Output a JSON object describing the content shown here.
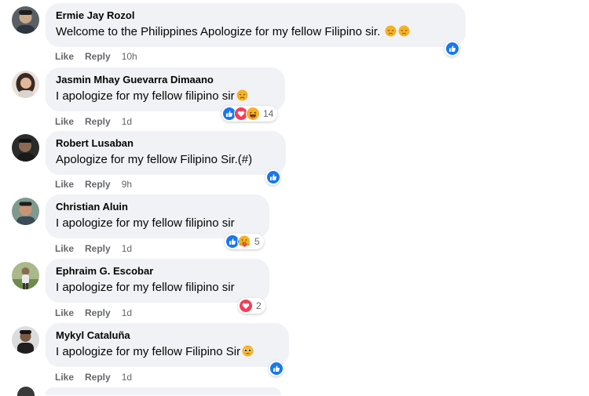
{
  "action_labels": {
    "like": "Like",
    "reply": "Reply"
  },
  "comments": [
    {
      "author": "Ermie Jay Rozol",
      "text": "Welcome to the Philippines Apologize for my fellow Filipino sir. ",
      "time": "10h",
      "emoji": [
        "downcast-face-icon",
        "downcast-face-icon"
      ],
      "reactions": [
        "like"
      ],
      "reaction_count": ""
    },
    {
      "author": "Jasmin Mhay Guevarra Dimaano",
      "text": "I apologize for my fellow filipino sir",
      "time": "1d",
      "emoji": [
        "disappointed-face-icon"
      ],
      "reactions": [
        "like",
        "love",
        "haha"
      ],
      "reaction_count": "14"
    },
    {
      "author": "Robert Lusaban",
      "text": "Apologize for my fellow Filipino Sir.(#)",
      "time": "9h",
      "emoji": [],
      "reactions": [
        "like"
      ],
      "reaction_count": ""
    },
    {
      "author": "Christian Aluin",
      "text": "I apologize for my fellow filipino sir",
      "time": "1d",
      "emoji": [],
      "reactions": [
        "like",
        "care"
      ],
      "reaction_count": "5"
    },
    {
      "author": "Ephraim G. Escobar",
      "text": "I apologize for my fellow filipino sir",
      "time": "1d",
      "emoji": [],
      "reactions": [
        "love"
      ],
      "reaction_count": "2"
    },
    {
      "author": "Mykyl Cataluña",
      "text": "I apologize for my fellow Filipino Sir",
      "time": "1d",
      "emoji": [
        "pleading-face-icon"
      ],
      "reactions": [
        "like"
      ],
      "reaction_count": ""
    }
  ],
  "colors": {
    "bubble_bg": "#f0f2f5",
    "meta_text": "#65676b",
    "like_blue": "#1877f2",
    "love_red": "#f33e58",
    "emoji_yellow": "#f7b125"
  }
}
